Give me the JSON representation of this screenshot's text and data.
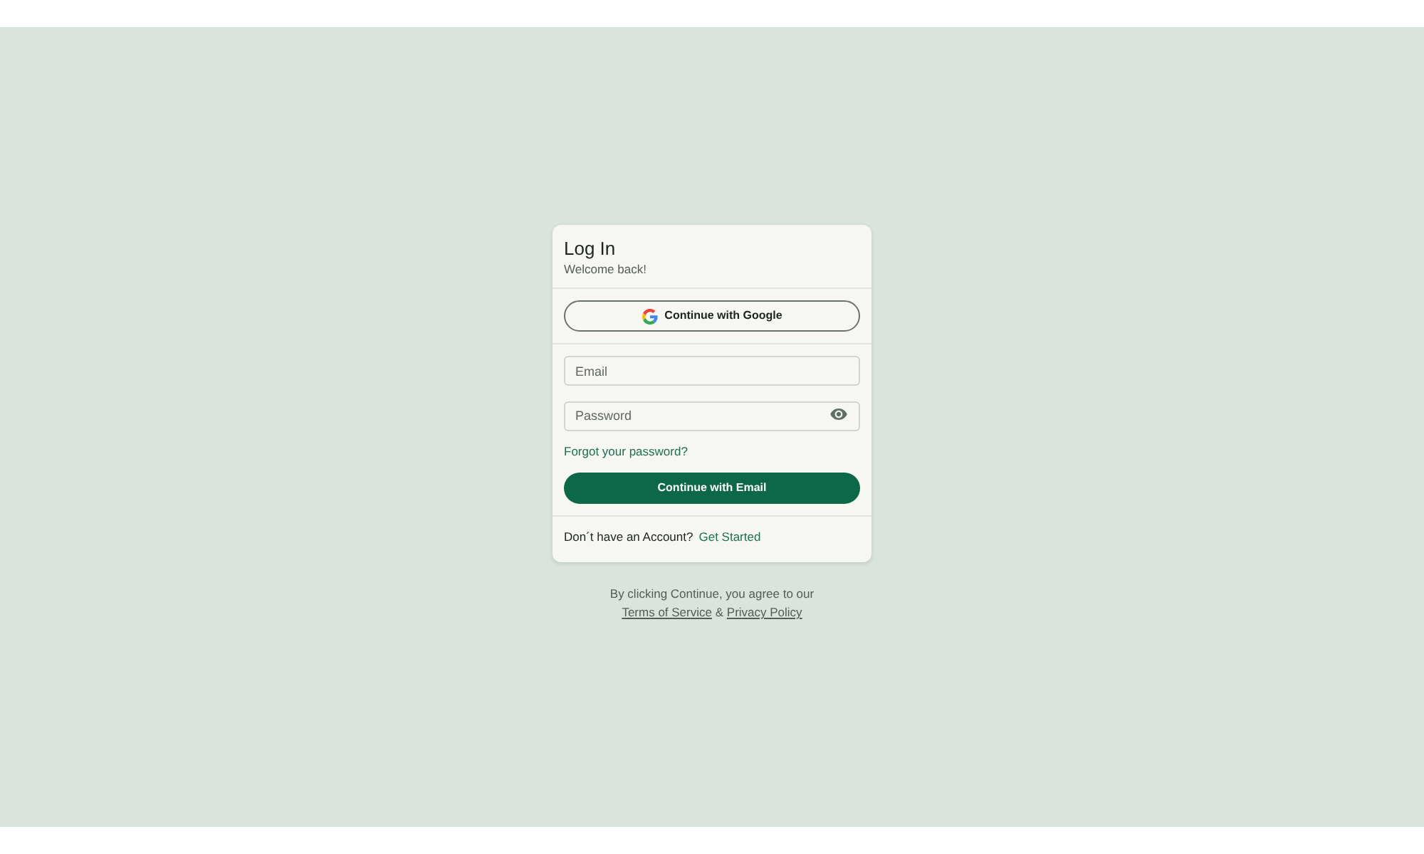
{
  "card": {
    "title": "Log In",
    "subtitle": "Welcome back!",
    "google_button": {
      "label": "Continue with Google"
    },
    "fields": [
      {
        "kind": "email",
        "placeholder": "Email"
      },
      {
        "kind": "password",
        "placeholder": "Password"
      }
    ],
    "forgot_link": "Forgot your password?",
    "submit_button": {
      "label": "Continue with Email"
    },
    "signup": {
      "prompt": "Don´t have an Account?",
      "link": "Get Started"
    }
  },
  "legal": {
    "text": "By clicking Continue, you agree to our",
    "terms_link": "Terms of Service",
    "joiner": "&",
    "privacy_link": "Privacy Policy"
  }
}
